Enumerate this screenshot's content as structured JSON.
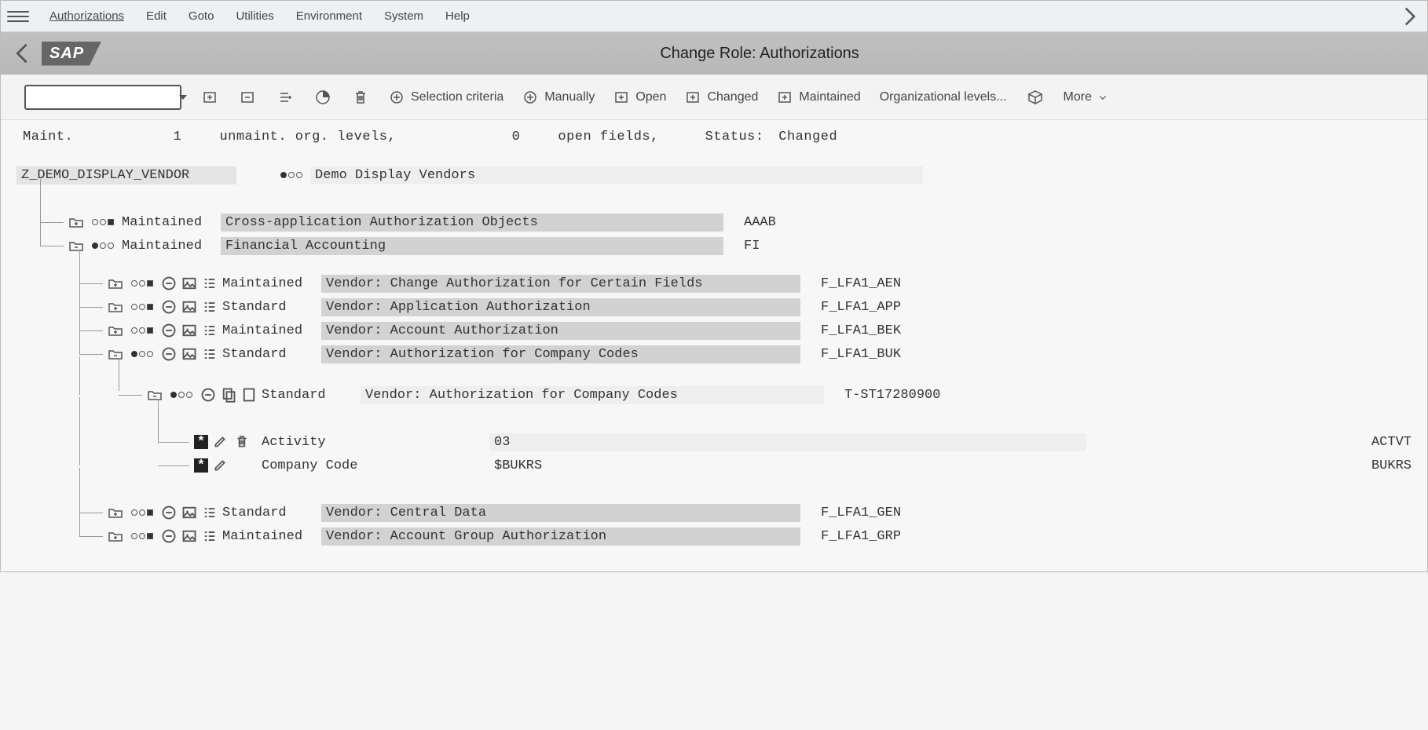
{
  "menubar": {
    "items": [
      "Authorizations",
      "Edit",
      "Goto",
      "Utilities",
      "Environment",
      "System",
      "Help"
    ]
  },
  "titlebar": {
    "logo": "SAP",
    "title": "Change Role: Authorizations"
  },
  "toolbar": {
    "tcode_value": "",
    "selection_criteria": "Selection criteria",
    "manually": "Manually",
    "open": "Open",
    "changed": "Changed",
    "maintained": "Maintained",
    "org_levels": "Organizational levels...",
    "more": "More"
  },
  "statusline": {
    "maint_label": "Maint.",
    "unmaint_count": "1",
    "unmaint_label": "unmaint. org. levels,",
    "open_count": "0",
    "open_label": "open fields,",
    "status_label": "Status:",
    "status_value": "Changed"
  },
  "role": {
    "name": "Z_DEMO_DISPLAY_VENDOR",
    "description": "Demo Display Vendors"
  },
  "tree": {
    "class1": {
      "status": "Maintained",
      "desc": "Cross-application Authorization Objects",
      "code": "AAAB"
    },
    "class2": {
      "status": "Maintained",
      "desc": "Financial Accounting",
      "code": "FI",
      "objects": [
        {
          "status": "Maintained",
          "desc": "Vendor: Change Authorization for Certain Fields",
          "code": "F_LFA1_AEN"
        },
        {
          "status": "Standard",
          "desc": "Vendor: Application Authorization",
          "code": "F_LFA1_APP"
        },
        {
          "status": "Maintained",
          "desc": "Vendor: Account Authorization",
          "code": "F_LFA1_BEK"
        },
        {
          "status": "Standard",
          "desc": "Vendor: Authorization for Company Codes",
          "code": "F_LFA1_BUK",
          "auth": {
            "status": "Standard",
            "desc": "Vendor: Authorization for Company Codes",
            "id": "T-ST17280900",
            "fields": [
              {
                "label": "Activity",
                "value": "03",
                "tech": "ACTVT",
                "has_delete": true
              },
              {
                "label": "Company Code",
                "value": "$BUKRS",
                "tech": "BUKRS",
                "has_delete": false
              }
            ]
          }
        },
        {
          "status": "Standard",
          "desc": "Vendor: Central Data",
          "code": "F_LFA1_GEN"
        },
        {
          "status": "Maintained",
          "desc": "Vendor: Account Group Authorization",
          "code": "F_LFA1_GRP"
        }
      ]
    }
  }
}
